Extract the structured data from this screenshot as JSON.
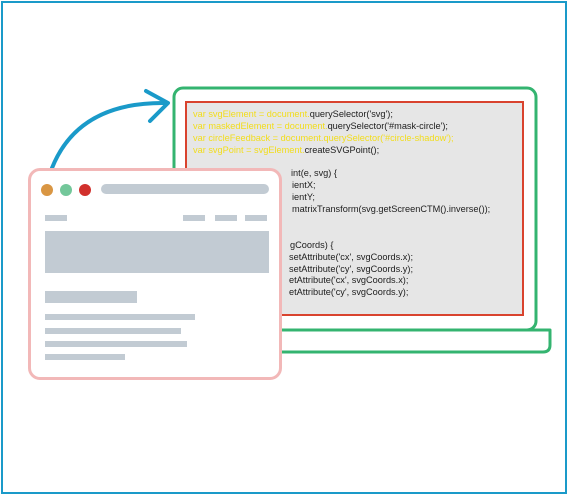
{
  "colors": {
    "frame": "#1a9ac9",
    "laptop": "#34b470",
    "code_border": "#d9432e",
    "code_bg": "#e6e6e6",
    "code_highlight": "#f2dd1c",
    "browser_border": "#f2b8b8",
    "placeholder": "#c2cbd3",
    "dot_orange": "#d99643",
    "dot_green": "#73c79a",
    "dot_red": "#d1302c"
  },
  "icons": {
    "arrow": "curved-arrow-icon"
  },
  "code": {
    "lines": [
      {
        "hl": "var svgElement = document.",
        "text": "querySelector('svg');"
      },
      {
        "hl": "var maskedElement = document.",
        "text": "querySelector('#mask-circle');"
      },
      {
        "hl": "var circleFeedback = document.querySelector('#circle-shadow');",
        "text": ""
      },
      {
        "hl": "var svgPoint = svgElement.",
        "text": "createSVGPoint();"
      },
      {
        "hl": "",
        "text": ""
      },
      {
        "hl": "",
        "text": "int(e, svg) {"
      },
      {
        "hl": "",
        "text": "ientX;"
      },
      {
        "hl": "",
        "text": "ientY;"
      },
      {
        "hl": "",
        "text": "matrixTransform(svg.getScreenCTM().inverse());"
      },
      {
        "hl": "",
        "text": ""
      },
      {
        "hl": "",
        "text": ""
      },
      {
        "hl": "",
        "text": "gCoords) {"
      },
      {
        "hl": "",
        "text": "setAttribute('cx', svgCoords.x);"
      },
      {
        "hl": "",
        "text": "setAttribute('cy', svgCoords.y);"
      },
      {
        "hl": "",
        "text": "etAttribute('cx', svgCoords.x);"
      },
      {
        "hl": "",
        "text": "etAttribute('cy', svgCoords.y);"
      }
    ]
  }
}
